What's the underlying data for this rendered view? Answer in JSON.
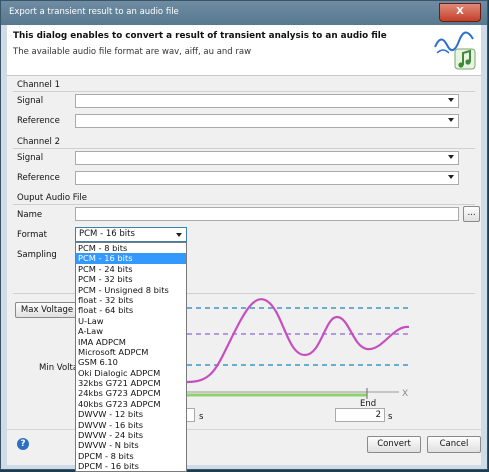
{
  "window": {
    "title": "Export a transient result to an audio file",
    "close_label": "X"
  },
  "header": {
    "heading": "This dialog enables to convert a result of transient analysis to an audio file",
    "subheading": "The available audio file format are wav, aiff, au and raw"
  },
  "channel1": {
    "section": "Channel 1",
    "signal_label": "Signal",
    "reference_label": "Reference"
  },
  "channel2": {
    "section": "Channel 2",
    "signal_label": "Signal",
    "reference_label": "Reference"
  },
  "output": {
    "section": "Ouput Audio File",
    "name_label": "Name",
    "browse_label": "...",
    "format_label": "Format",
    "format_value": "PCM - 16 bits",
    "sampling_label": "Sampling",
    "format_options": [
      "PCM - 8 bits",
      "PCM - 16 bits",
      "PCM - 24 bits",
      "PCM - 32 bits",
      "PCM - Unsigned 8 bits",
      "float - 32 bits",
      "float - 64 bits",
      "U-Law",
      "A-Law",
      "IMA ADPCM",
      "Microsoft ADPCM",
      "GSM 6.10",
      "Oki Dialogic ADPCM",
      "32kbs G721 ADPCM",
      "24kbs G723 ADPCM",
      "40kbs G723 ADPCM",
      "DWVW - 12 bits",
      "DWVW - 16 bits",
      "DWVW - 24 bits",
      "DWVW - N bits",
      "DPCM - 8 bits",
      "DPCM - 16 bits"
    ],
    "selected_index": 1
  },
  "voltage": {
    "max_button": "Max Voltage",
    "min_label": "Min Volta"
  },
  "time": {
    "end_label": "End",
    "end_value": "2",
    "start_unit": "s",
    "end_unit": "s",
    "x_axis": "X"
  },
  "footer": {
    "convert_label": "Convert",
    "cancel_label": "Cancel",
    "help_label": "?"
  }
}
